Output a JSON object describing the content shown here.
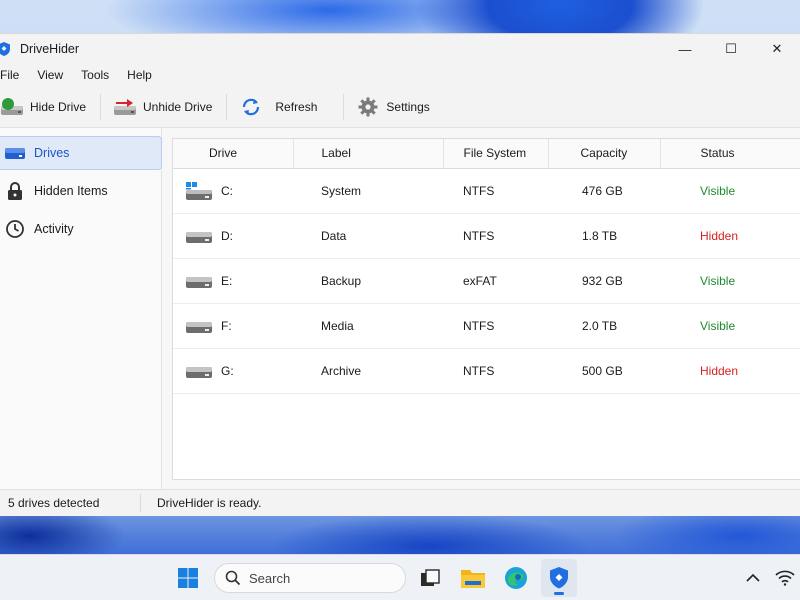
{
  "window": {
    "title": "DriveHider",
    "controls": {
      "minimize": "—",
      "maximize": "☐",
      "close": "✕"
    }
  },
  "menu": [
    "File",
    "View",
    "Tools",
    "Help"
  ],
  "toolbar": {
    "hide_drive": "Hide Drive",
    "unhide_drive": "Unhide Drive",
    "refresh": "Refresh",
    "settings": "Settings"
  },
  "sidebar": {
    "items": [
      {
        "label": "Drives",
        "icon": "drive-icon",
        "active": true
      },
      {
        "label": "Hidden Items",
        "icon": "lock-icon",
        "active": false
      },
      {
        "label": "Activity",
        "icon": "clock-icon",
        "active": false
      }
    ]
  },
  "table": {
    "headers": [
      "Drive",
      "Label",
      "File System",
      "Capacity",
      "Status"
    ],
    "rows": [
      {
        "drive": "C:",
        "label": "System",
        "fs": "NTFS",
        "capacity": "476 GB",
        "status": "Visible",
        "icon": "windows-drive-icon"
      },
      {
        "drive": "D:",
        "label": "Data",
        "fs": "NTFS",
        "capacity": "1.8 TB",
        "status": "Hidden",
        "icon": "hard-drive-icon"
      },
      {
        "drive": "E:",
        "label": "Backup",
        "fs": "exFAT",
        "capacity": "932 GB",
        "status": "Visible",
        "icon": "hard-drive-icon"
      },
      {
        "drive": "F:",
        "label": "Media",
        "fs": "NTFS",
        "capacity": "2.0 TB",
        "status": "Visible",
        "icon": "hard-drive-icon"
      },
      {
        "drive": "G:",
        "label": "Archive",
        "fs": "NTFS",
        "capacity": "500 GB",
        "status": "Hidden",
        "icon": "hard-drive-icon"
      }
    ]
  },
  "statusbar": {
    "count": "5 drives detected",
    "message": "DriveHider is ready."
  },
  "taskbar": {
    "search_label": "Search"
  },
  "colors": {
    "visible": "#1e8a2e",
    "hidden": "#d61f1f",
    "accent": "#1a56c8"
  }
}
